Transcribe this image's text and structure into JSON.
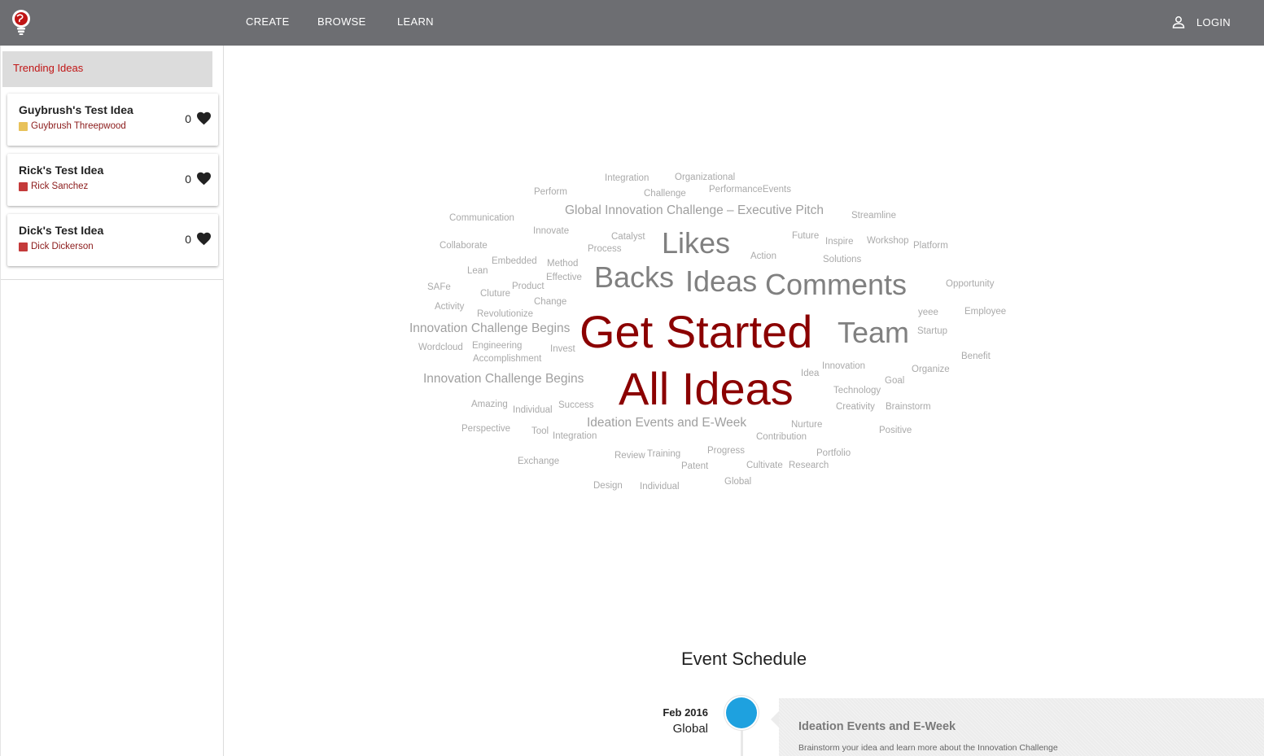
{
  "nav": {
    "logo_icon": "lightbulb-globe-icon",
    "items": [
      {
        "label": "CREATE"
      },
      {
        "label": "BROWSE"
      },
      {
        "label": "LEARN"
      }
    ],
    "login_label": "LOGIN",
    "login_icon": "user-icon"
  },
  "sidebar": {
    "header": "Trending Ideas",
    "ideas": [
      {
        "title": "Guybrush's Test Idea",
        "author": "Guybrush Threepwood",
        "likes": "0",
        "avatar_color": "#e8c25a"
      },
      {
        "title": "Rick's Test Idea",
        "author": "Rick Sanchez",
        "likes": "0",
        "avatar_color": "#c43a3a"
      },
      {
        "title": "Dick's Test Idea",
        "author": "Dick Dickerson",
        "likes": "0",
        "avatar_color": "#c43a3a"
      }
    ]
  },
  "word_cloud": {
    "words": [
      "Integration",
      "Organizational",
      "Perform",
      "Challenge",
      "PerformanceEvents",
      "Global Innovation Challenge – Executive Pitch",
      "Streamline",
      "Communication",
      "Innovate",
      "Catalyst",
      "Likes",
      "Future",
      "Inspire",
      "Workshop",
      "Platform",
      "Collaborate",
      "Process",
      "Action",
      "Solutions",
      "Embedded",
      "Method",
      "Lean",
      "Effective",
      "Backs",
      "Ideas",
      "Comments",
      "Opportunity",
      "SAFe",
      "Product",
      "Cluture",
      "Change",
      "Activity",
      "Revolutionize",
      "yeee",
      "Employee",
      "Innovation Challenge Begins",
      "Get Started",
      "Team",
      "Startup",
      "Wordcloud",
      "Engineering",
      "Invest",
      "Accomplishment",
      "Benefit",
      "Innovation",
      "Idea",
      "Organize",
      "Innovation Challenge Begins",
      "All Ideas",
      "Goal",
      "Technology",
      "Amazing",
      "Success",
      "Individual",
      "Creativity",
      "Brainstorm",
      "Ideation Events and E-Week",
      "Perspective",
      "Tool",
      "Integration",
      "Nurture",
      "Contribution",
      "Positive",
      "Progress",
      "Review",
      "Training",
      "Portfolio",
      "Exchange",
      "Patent",
      "Cultivate",
      "Research",
      "Global",
      "Design",
      "Individual"
    ]
  },
  "events": {
    "title": "Event Schedule",
    "items": [
      {
        "date": "Feb 2016",
        "location": "Global",
        "title": "Ideation Events and E-Week",
        "description": "Brainstorm your idea and learn more about the Innovation Challenge",
        "dot_color": "#1ea1df"
      }
    ]
  }
}
